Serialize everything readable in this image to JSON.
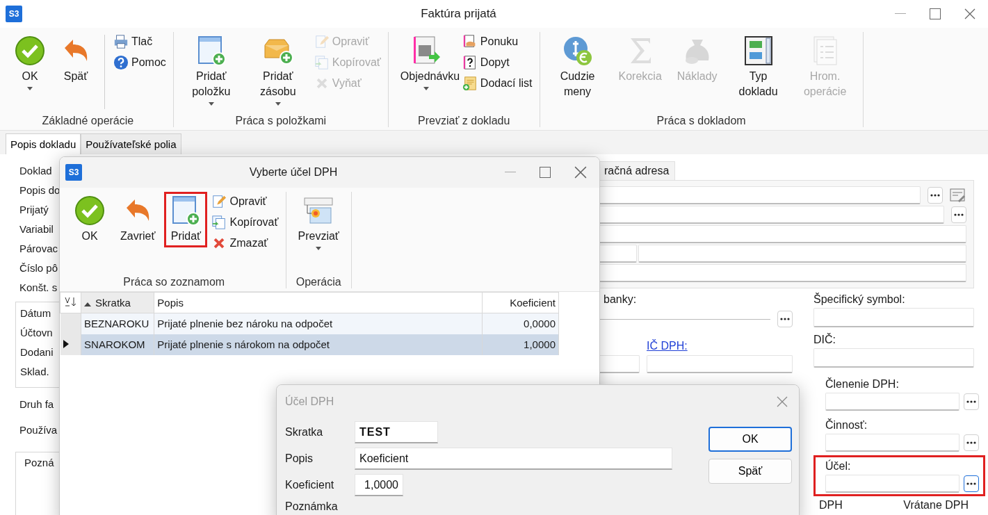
{
  "window": {
    "badge": "S3",
    "title": "Faktúra prijatá"
  },
  "ribbon": {
    "groups": [
      {
        "label": "Základné operácie",
        "items": [
          {
            "kind": "large",
            "label": "OK",
            "dropdown": true,
            "disabled": false
          },
          {
            "kind": "large",
            "label": "Späť",
            "dropdown": false,
            "disabled": false
          },
          {
            "kind": "separator"
          },
          {
            "kind": "stack",
            "items": [
              {
                "label": "Tlač",
                "disabled": false
              },
              {
                "label": "Pomoc",
                "disabled": false
              }
            ]
          }
        ]
      },
      {
        "label": "Práca s položkami",
        "items": [
          {
            "kind": "large",
            "label": "Pridať položku",
            "dropdown": true,
            "disabled": false
          },
          {
            "kind": "large",
            "label": "Pridať zásobu",
            "dropdown": true,
            "disabled": false
          },
          {
            "kind": "stack",
            "items": [
              {
                "label": "Opraviť",
                "disabled": true
              },
              {
                "label": "Kopírovať",
                "disabled": true
              },
              {
                "label": "Vyňať",
                "disabled": true
              }
            ]
          }
        ]
      },
      {
        "label": "Prevziať z dokladu",
        "items": [
          {
            "kind": "large",
            "label": "Objednávku",
            "dropdown": true,
            "disabled": false
          },
          {
            "kind": "stack",
            "items": [
              {
                "label": "Ponuku",
                "disabled": false
              },
              {
                "label": "Dopyt",
                "disabled": false
              },
              {
                "label": "Dodací list",
                "disabled": false
              }
            ]
          }
        ]
      },
      {
        "label": "Práca s dokladom",
        "items": [
          {
            "kind": "large",
            "label": "Cudzie meny",
            "dropdown": false,
            "disabled": false
          },
          {
            "kind": "large",
            "label": "Korekcia",
            "dropdown": false,
            "disabled": true
          },
          {
            "kind": "large",
            "label": "Náklady",
            "dropdown": false,
            "disabled": true
          },
          {
            "kind": "large",
            "label": "Typ dokladu",
            "dropdown": false,
            "disabled": false
          },
          {
            "kind": "large",
            "label": "Hrom. operácie",
            "dropdown": false,
            "disabled": true
          }
        ]
      }
    ]
  },
  "tabs": [
    {
      "label": "Popis dokladu",
      "selected": true
    },
    {
      "label": "Používateľské polia",
      "selected": false
    }
  ],
  "form": {
    "labels_top": [
      "Doklad",
      "Popis do",
      "Prijatý",
      "Variabil",
      "Párovac",
      "Číslo pô",
      "Konšt. s"
    ],
    "dates_group": [
      "Dátum",
      "Účtovn",
      "Dodani",
      "Sklad."
    ],
    "labels_bottom": [
      "Druh fa",
      "Používa"
    ],
    "note_tab": "Pozná",
    "address_tab": "račná adresa",
    "bank_label": "banky:",
    "specific_symbol_label": "Špecifický symbol:",
    "vat_id_link": "IČ DPH:",
    "tax_id_label": "DIČ:",
    "side_fields": [
      {
        "label": "Členenie DPH:",
        "highlighted": false
      },
      {
        "label": "Činnosť:",
        "highlighted": false
      },
      {
        "label": "Účel:",
        "highlighted": true
      }
    ],
    "totals": [
      "DPH",
      "Vrátane DPH"
    ]
  },
  "select_dialog": {
    "badge": "S3",
    "title": "Vyberte účel DPH",
    "ribbon": {
      "groups": [
        {
          "label": "Práca so zoznamom",
          "items": [
            {
              "kind": "large",
              "label": "OK",
              "dropdown": false,
              "disabled": false,
              "highlighted": false
            },
            {
              "kind": "large",
              "label": "Zavrieť",
              "dropdown": false,
              "disabled": false,
              "highlighted": false
            },
            {
              "kind": "large",
              "label": "Pridať",
              "dropdown": false,
              "disabled": false,
              "highlighted": true
            },
            {
              "kind": "stack",
              "items": [
                {
                  "label": "Opraviť",
                  "disabled": false
                },
                {
                  "label": "Kopírovať",
                  "disabled": false
                },
                {
                  "label": "Zmazať",
                  "disabled": false
                }
              ]
            }
          ]
        },
        {
          "label": "Operácia",
          "items": [
            {
              "kind": "large",
              "label": "Prevziať",
              "dropdown": true,
              "disabled": false,
              "highlighted": false
            }
          ]
        }
      ]
    },
    "table": {
      "columns": [
        {
          "label": "Skratka",
          "sorted": true
        },
        {
          "label": "Popis",
          "sorted": false
        },
        {
          "label": "Koeficient",
          "sorted": false
        }
      ],
      "rows": [
        {
          "cells": [
            "BEZNAROKU",
            "Prijaté plnenie bez nároku na odpočet",
            "0,0000"
          ],
          "selected": false
        },
        {
          "cells": [
            "SNAROKOM",
            "Prijaté plnenie s nárokom na odpočet",
            "1,0000"
          ],
          "selected": true
        }
      ]
    }
  },
  "edit_dialog": {
    "title": "Účel DPH",
    "fields": [
      {
        "label": "Skratka",
        "value": "TEST"
      },
      {
        "label": "Popis",
        "value": "Koeficient"
      },
      {
        "label": "Koeficient",
        "value": "1,0000"
      }
    ],
    "buttons": [
      {
        "label": "OK",
        "default": true
      },
      {
        "label": "Späť",
        "default": false
      }
    ],
    "note_label": "Poznámka"
  }
}
